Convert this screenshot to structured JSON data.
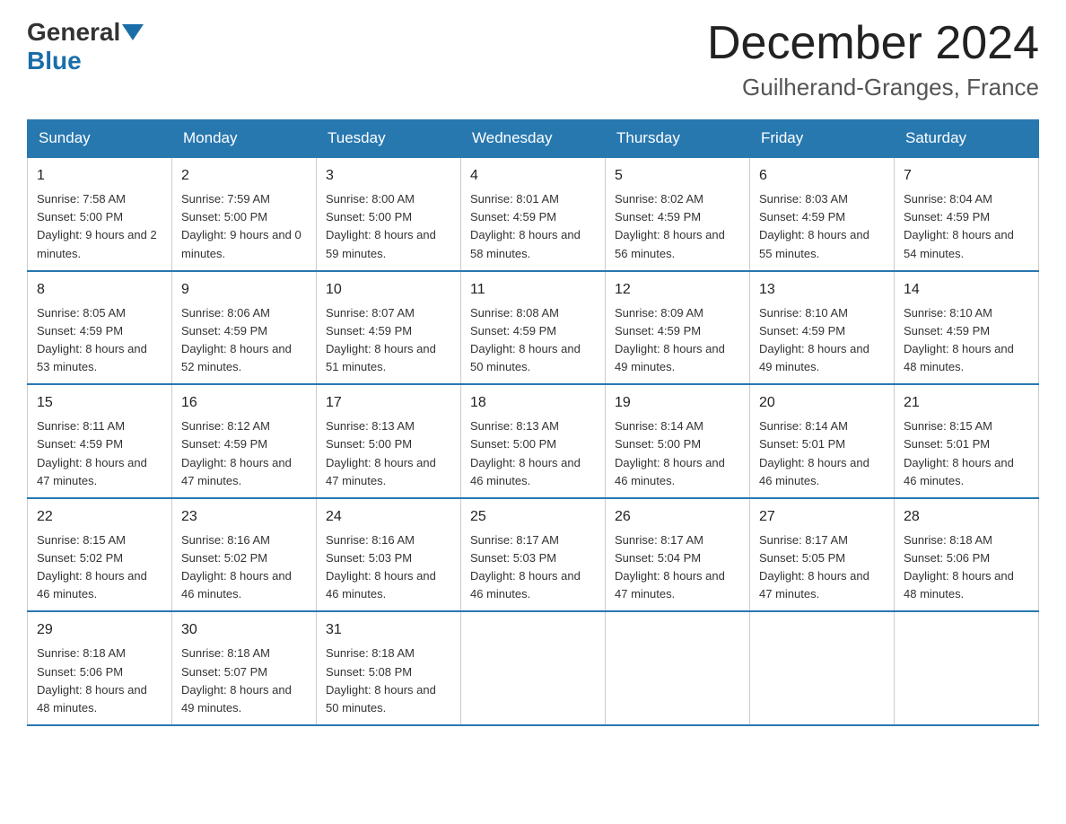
{
  "logo": {
    "general": "General",
    "blue": "Blue"
  },
  "header": {
    "month": "December 2024",
    "location": "Guilherand-Granges, France"
  },
  "weekdays": [
    "Sunday",
    "Monday",
    "Tuesday",
    "Wednesday",
    "Thursday",
    "Friday",
    "Saturday"
  ],
  "weeks": [
    [
      {
        "day": "1",
        "sunrise": "7:58 AM",
        "sunset": "5:00 PM",
        "daylight": "9 hours and 2 minutes."
      },
      {
        "day": "2",
        "sunrise": "7:59 AM",
        "sunset": "5:00 PM",
        "daylight": "9 hours and 0 minutes."
      },
      {
        "day": "3",
        "sunrise": "8:00 AM",
        "sunset": "5:00 PM",
        "daylight": "8 hours and 59 minutes."
      },
      {
        "day": "4",
        "sunrise": "8:01 AM",
        "sunset": "4:59 PM",
        "daylight": "8 hours and 58 minutes."
      },
      {
        "day": "5",
        "sunrise": "8:02 AM",
        "sunset": "4:59 PM",
        "daylight": "8 hours and 56 minutes."
      },
      {
        "day": "6",
        "sunrise": "8:03 AM",
        "sunset": "4:59 PM",
        "daylight": "8 hours and 55 minutes."
      },
      {
        "day": "7",
        "sunrise": "8:04 AM",
        "sunset": "4:59 PM",
        "daylight": "8 hours and 54 minutes."
      }
    ],
    [
      {
        "day": "8",
        "sunrise": "8:05 AM",
        "sunset": "4:59 PM",
        "daylight": "8 hours and 53 minutes."
      },
      {
        "day": "9",
        "sunrise": "8:06 AM",
        "sunset": "4:59 PM",
        "daylight": "8 hours and 52 minutes."
      },
      {
        "day": "10",
        "sunrise": "8:07 AM",
        "sunset": "4:59 PM",
        "daylight": "8 hours and 51 minutes."
      },
      {
        "day": "11",
        "sunrise": "8:08 AM",
        "sunset": "4:59 PM",
        "daylight": "8 hours and 50 minutes."
      },
      {
        "day": "12",
        "sunrise": "8:09 AM",
        "sunset": "4:59 PM",
        "daylight": "8 hours and 49 minutes."
      },
      {
        "day": "13",
        "sunrise": "8:10 AM",
        "sunset": "4:59 PM",
        "daylight": "8 hours and 49 minutes."
      },
      {
        "day": "14",
        "sunrise": "8:10 AM",
        "sunset": "4:59 PM",
        "daylight": "8 hours and 48 minutes."
      }
    ],
    [
      {
        "day": "15",
        "sunrise": "8:11 AM",
        "sunset": "4:59 PM",
        "daylight": "8 hours and 47 minutes."
      },
      {
        "day": "16",
        "sunrise": "8:12 AM",
        "sunset": "4:59 PM",
        "daylight": "8 hours and 47 minutes."
      },
      {
        "day": "17",
        "sunrise": "8:13 AM",
        "sunset": "5:00 PM",
        "daylight": "8 hours and 47 minutes."
      },
      {
        "day": "18",
        "sunrise": "8:13 AM",
        "sunset": "5:00 PM",
        "daylight": "8 hours and 46 minutes."
      },
      {
        "day": "19",
        "sunrise": "8:14 AM",
        "sunset": "5:00 PM",
        "daylight": "8 hours and 46 minutes."
      },
      {
        "day": "20",
        "sunrise": "8:14 AM",
        "sunset": "5:01 PM",
        "daylight": "8 hours and 46 minutes."
      },
      {
        "day": "21",
        "sunrise": "8:15 AM",
        "sunset": "5:01 PM",
        "daylight": "8 hours and 46 minutes."
      }
    ],
    [
      {
        "day": "22",
        "sunrise": "8:15 AM",
        "sunset": "5:02 PM",
        "daylight": "8 hours and 46 minutes."
      },
      {
        "day": "23",
        "sunrise": "8:16 AM",
        "sunset": "5:02 PM",
        "daylight": "8 hours and 46 minutes."
      },
      {
        "day": "24",
        "sunrise": "8:16 AM",
        "sunset": "5:03 PM",
        "daylight": "8 hours and 46 minutes."
      },
      {
        "day": "25",
        "sunrise": "8:17 AM",
        "sunset": "5:03 PM",
        "daylight": "8 hours and 46 minutes."
      },
      {
        "day": "26",
        "sunrise": "8:17 AM",
        "sunset": "5:04 PM",
        "daylight": "8 hours and 47 minutes."
      },
      {
        "day": "27",
        "sunrise": "8:17 AM",
        "sunset": "5:05 PM",
        "daylight": "8 hours and 47 minutes."
      },
      {
        "day": "28",
        "sunrise": "8:18 AM",
        "sunset": "5:06 PM",
        "daylight": "8 hours and 48 minutes."
      }
    ],
    [
      {
        "day": "29",
        "sunrise": "8:18 AM",
        "sunset": "5:06 PM",
        "daylight": "8 hours and 48 minutes."
      },
      {
        "day": "30",
        "sunrise": "8:18 AM",
        "sunset": "5:07 PM",
        "daylight": "8 hours and 49 minutes."
      },
      {
        "day": "31",
        "sunrise": "8:18 AM",
        "sunset": "5:08 PM",
        "daylight": "8 hours and 50 minutes."
      },
      null,
      null,
      null,
      null
    ]
  ]
}
